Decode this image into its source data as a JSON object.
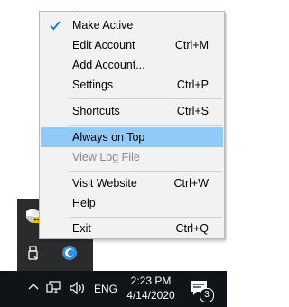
{
  "menu": {
    "items": [
      {
        "label": "Make Active",
        "shortcut": "",
        "checked": true
      },
      {
        "label": "Edit Account",
        "shortcut": "Ctrl+M"
      },
      {
        "label": "Add Account...",
        "shortcut": ""
      },
      {
        "label": "Settings",
        "shortcut": "Ctrl+P"
      },
      {
        "label": "Shortcuts",
        "shortcut": "Ctrl+S"
      },
      {
        "label": "Always on Top",
        "shortcut": "",
        "highlighted": true
      },
      {
        "label": "View Log File",
        "shortcut": "",
        "disabled": true
      },
      {
        "label": "Visit Website",
        "shortcut": "Ctrl+W"
      },
      {
        "label": "Help",
        "shortcut": ""
      },
      {
        "label": "Exit",
        "shortcut": "Ctrl+Q"
      }
    ]
  },
  "taskbar": {
    "language": "ENG",
    "time": "2:23 PM",
    "date": "4/14/2020",
    "notification_count": "3"
  },
  "colors": {
    "highlight": "#91c9f7",
    "taskbar": "#101318",
    "tray_panel": "#2b2b2b"
  }
}
